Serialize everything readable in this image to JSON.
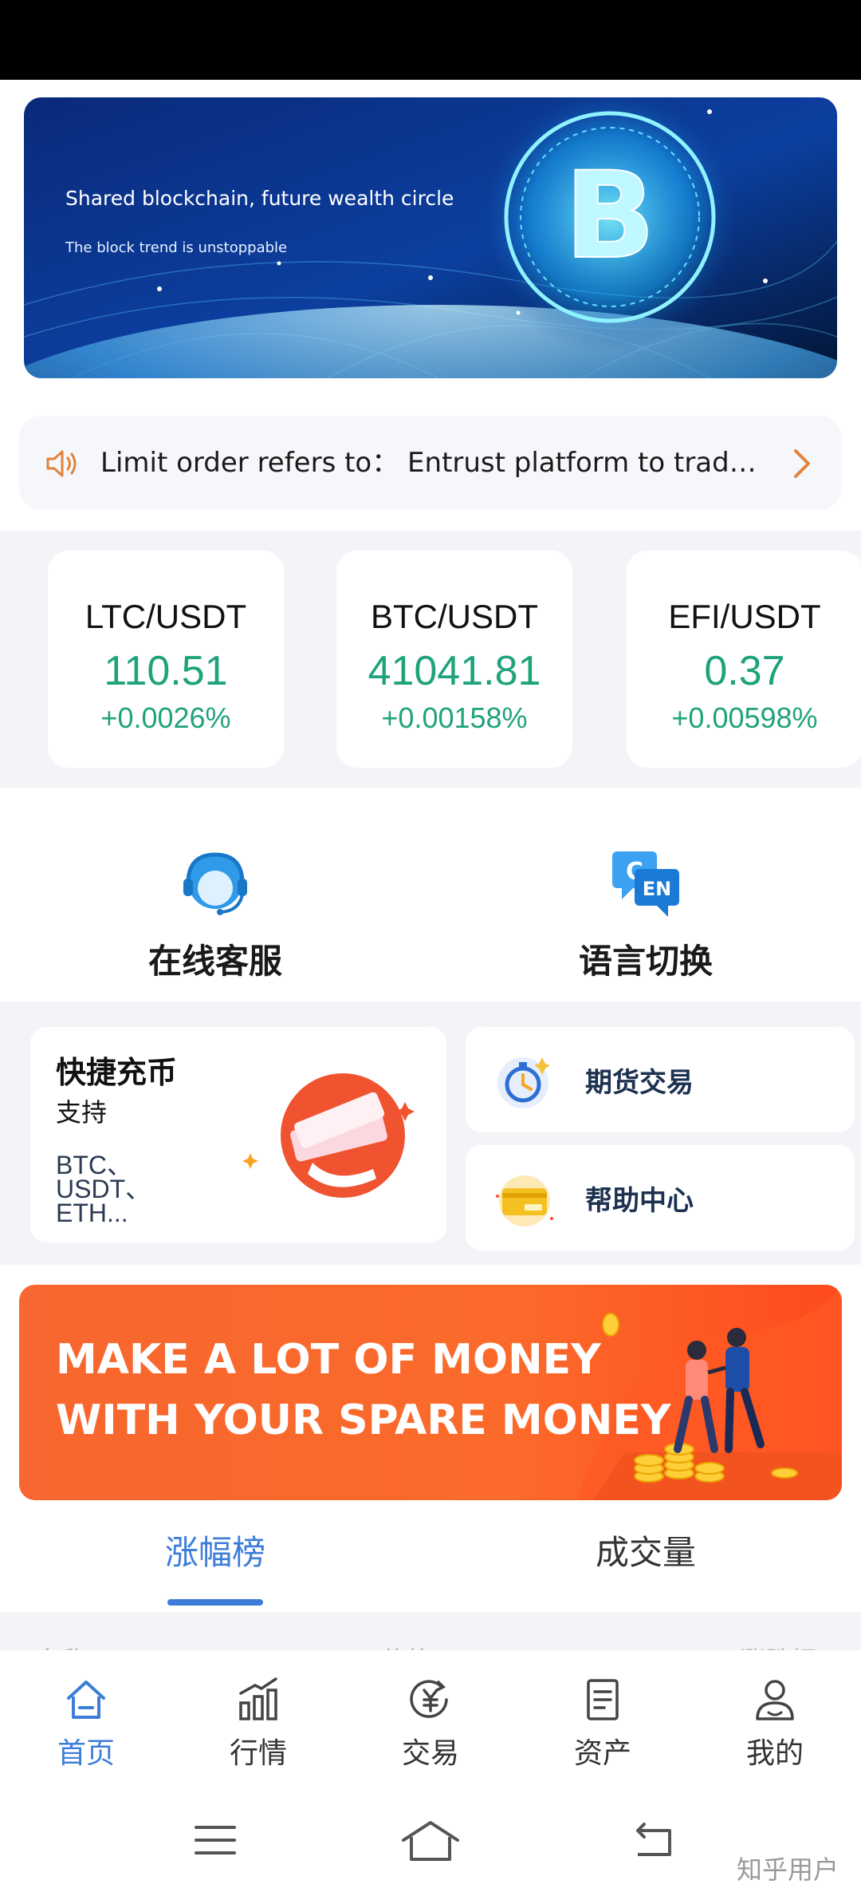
{
  "hero_banner": {
    "title": "Shared blockchain, future wealth circle",
    "subtitle": "The block trend is unstoppable"
  },
  "notice": {
    "text": "Limit order refers to： Entrust platform to trad…",
    "icon": "speaker-icon",
    "arrow_icon": "chevron-right-icon",
    "accent_color": "#e0823a"
  },
  "tickers": [
    {
      "pair": "LTC/USDT",
      "price": "110.51",
      "change": "+0.0026%"
    },
    {
      "pair": "BTC/USDT",
      "price": "41041.81",
      "change": "+0.00158%"
    },
    {
      "pair": "EFI/USDT",
      "price": "0.37",
      "change": "+0.00598%"
    }
  ],
  "ticker_up_color": "#1fa37c",
  "quick_links": {
    "support": {
      "label": "在线客服",
      "icon": "customer-service-icon"
    },
    "language": {
      "label": "语言切换",
      "icon": "language-switch-icon"
    }
  },
  "deposit_card": {
    "title": "快捷充币",
    "support": "支持",
    "coins": "BTC、USDT、ETH..."
  },
  "side_cards": [
    {
      "label": "期货交易",
      "icon": "futures-stopwatch-icon"
    },
    {
      "label": "帮助中心",
      "icon": "help-card-icon"
    }
  ],
  "promo": {
    "line1": "MAKE A LOT OF MONEY",
    "line2": "WITH YOUR SPARE MONEY"
  },
  "ranking_tabs": [
    {
      "label": "涨幅榜",
      "active": true
    },
    {
      "label": "成交量",
      "active": false
    }
  ],
  "table_header": {
    "name": "名称",
    "price": "价格",
    "change": "涨跌幅"
  },
  "bottom_nav": [
    {
      "label": "首页",
      "icon": "home-icon",
      "active": true
    },
    {
      "label": "行情",
      "icon": "market-chart-icon",
      "active": false
    },
    {
      "label": "交易",
      "icon": "trade-yen-icon",
      "active": false
    },
    {
      "label": "资产",
      "icon": "assets-document-icon",
      "active": false
    },
    {
      "label": "我的",
      "icon": "profile-icon",
      "active": false
    }
  ],
  "accent_color": "#3d7dd8",
  "watermark": "知乎用户"
}
